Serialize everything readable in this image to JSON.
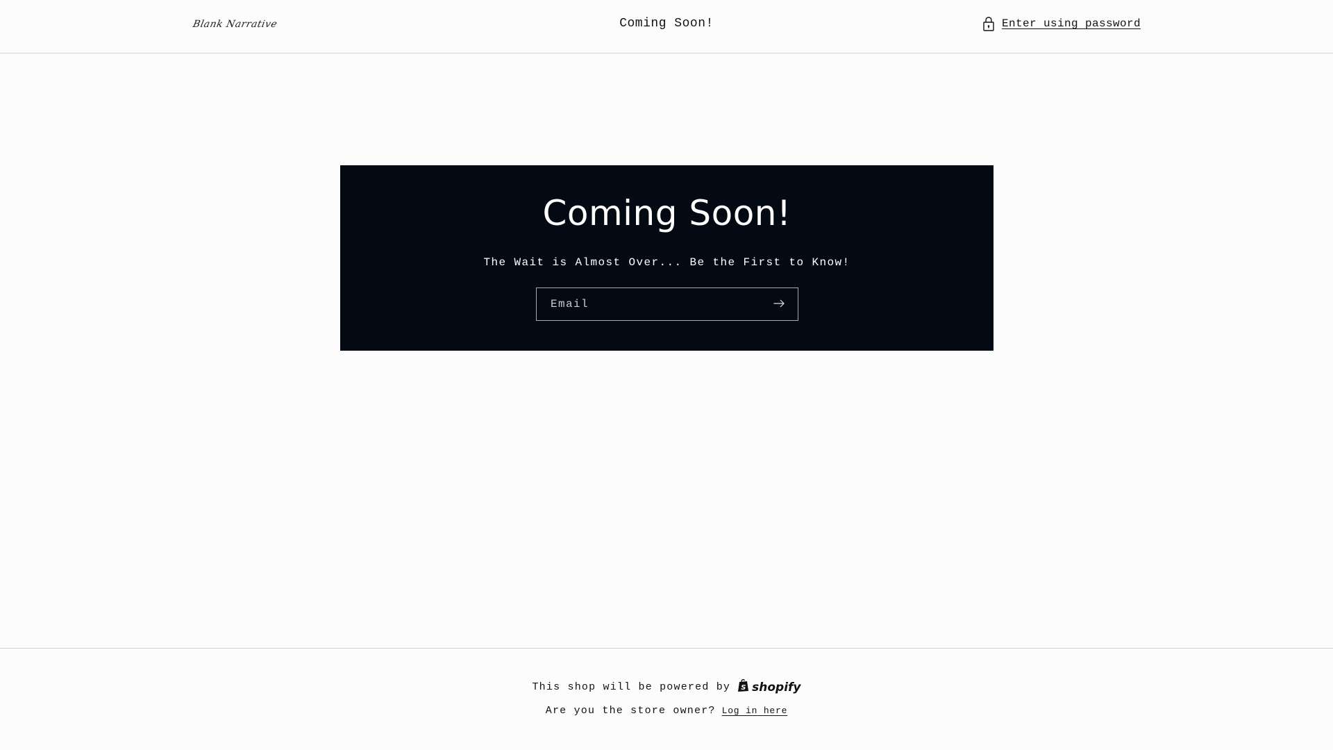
{
  "header": {
    "logo_text": "Blank Narrative",
    "title": "Coming Soon!",
    "password_link": "Enter using password",
    "password_icon": "lock-icon"
  },
  "banner": {
    "title": "Coming Soon!",
    "subtitle": "The Wait is Almost Over... Be the First to Know!",
    "email_placeholder": "Email",
    "email_value": "",
    "submit_icon": "arrow-right-icon",
    "background_color": "#040a14"
  },
  "footer": {
    "powered_text": "This shop will be powered by",
    "shopify_text": "shopify",
    "owner_text": "Are you the store owner?",
    "login_link": "Log in here"
  }
}
